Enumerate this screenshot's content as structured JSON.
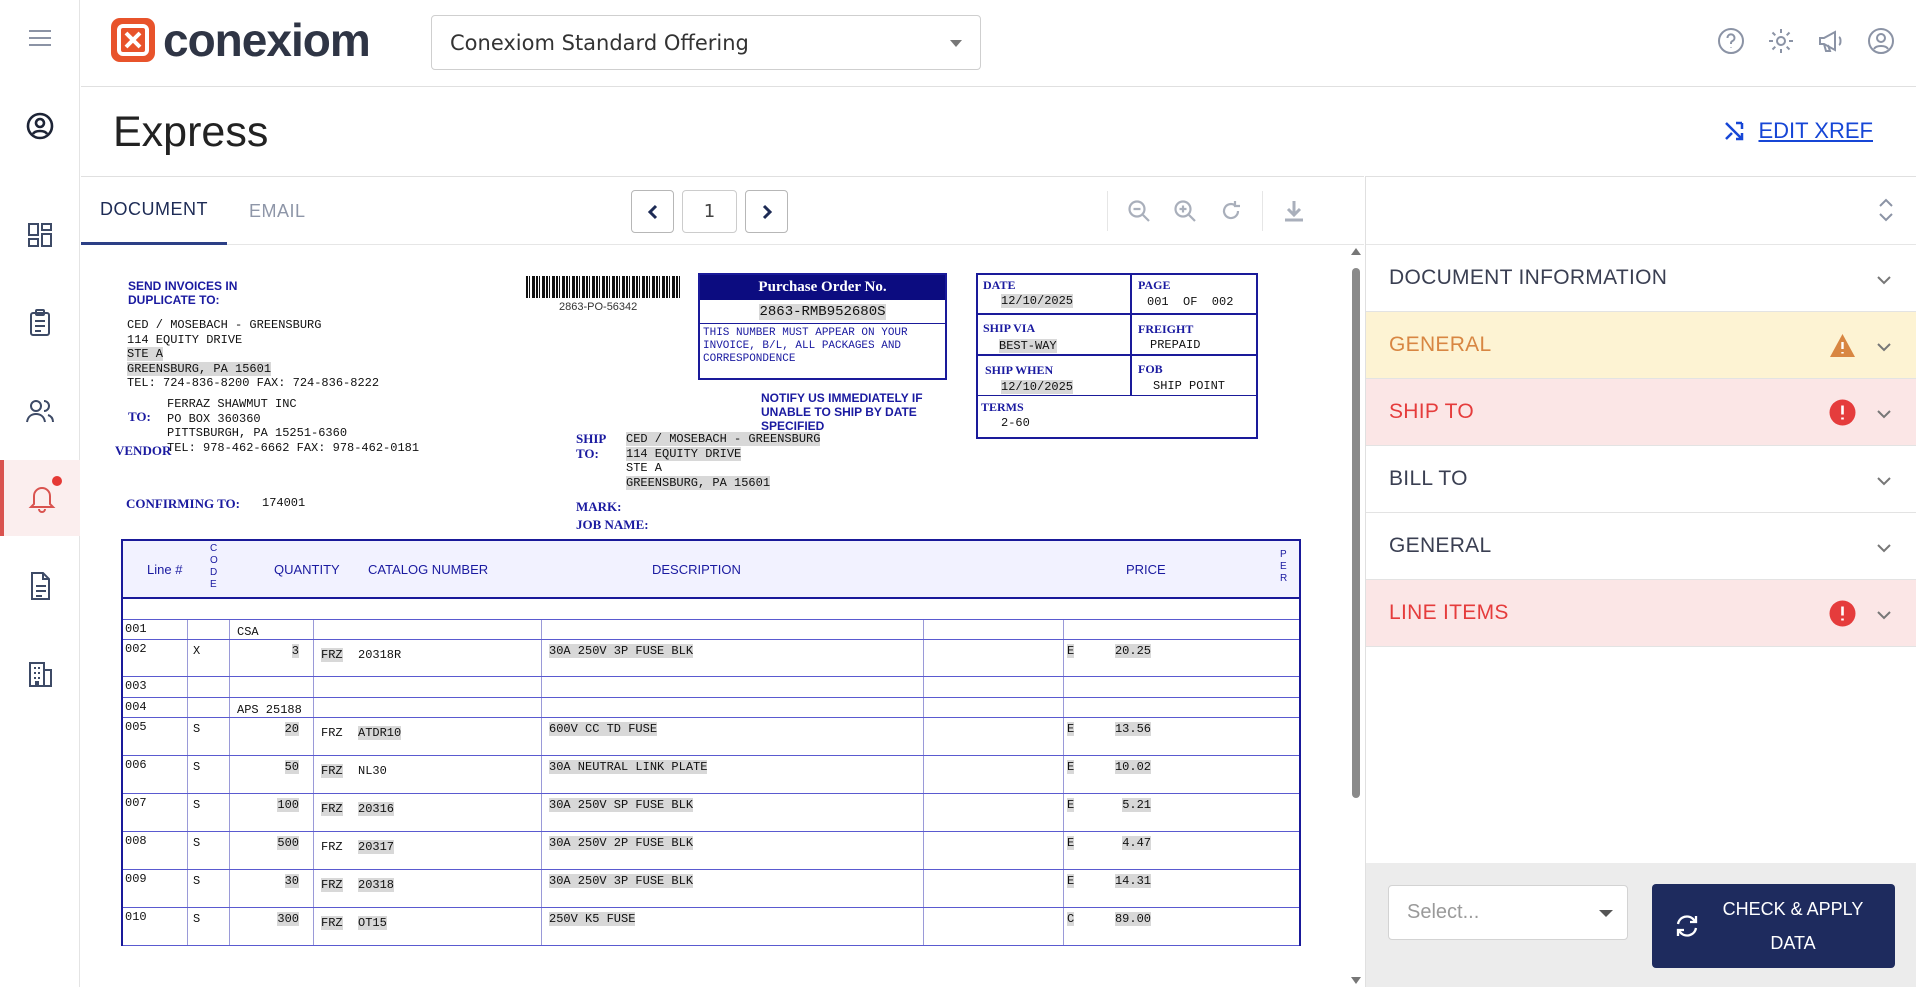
{
  "header": {
    "brand": "conexiom",
    "offering_select": "Conexiom Standard Offering",
    "icons": [
      "help-icon",
      "settings-icon",
      "announcement-icon",
      "account-icon"
    ]
  },
  "nav": {
    "items": [
      "profile-icon",
      "dashboard-icon",
      "clipboard-icon",
      "users-icon",
      "notifications-icon",
      "document-icon",
      "building-icon"
    ],
    "notification_dot_color": "#e53935"
  },
  "page": {
    "title": "Express",
    "edit_xref": "EDIT XREF"
  },
  "viewer": {
    "tabs": [
      "DOCUMENT",
      "EMAIL"
    ],
    "page_number": "1"
  },
  "document": {
    "send_invoices": "SEND INVOICES IN\nDUPLICATE TO:",
    "bill_addr": [
      "CED / MOSEBACH - GREENSBURG",
      "114 EQUITY DRIVE",
      "STE A",
      "GREENSBURG,   PA   15601",
      "TEL: 724-836-8200    FAX: 724-836-8222"
    ],
    "to_label": "TO:",
    "vendor_label": "VENDOR",
    "vendor_addr": [
      "FERRAZ SHAWMUT INC",
      "PO BOX 360360",
      "PITTSBURGH, PA 15251-6360",
      "TEL: 978-462-6662 FAX: 978-462-0181"
    ],
    "confirming_label": "CONFIRMING TO:",
    "confirming_value": "174001",
    "barcode_text": "2863-PO-56342",
    "po_title": "Purchase Order No.",
    "po_number": "2863-RMB952680S",
    "po_message": "THIS NUMBER MUST APPEAR ON YOUR INVOICE, B/L, ALL PACKAGES AND CORRESPONDENCE",
    "notify": "NOTIFY US IMMEDIATELY IF\nUNABLE TO SHIP BY DATE\nSPECIFIED",
    "ship_to_label": "SHIP\nTO:",
    "ship_addr": [
      "CED / MOSEBACH - GREENSBURG",
      "114 EQUITY DRIVE",
      "STE A",
      "GREENSBURG, PA 15601"
    ],
    "mark_label": "MARK:",
    "job_label": "JOB NAME:",
    "date_label": "DATE",
    "date_value": "12/10/2025",
    "page_label": "PAGE",
    "page_value": "001  OF  002",
    "ship_via_label": "SHIP VIA",
    "ship_via_value": "BEST-WAY",
    "freight_label": "FREIGHT",
    "freight_value": "PREPAID",
    "ship_when_label": "SHIP WHEN",
    "ship_when_value": "12/10/2025",
    "fob_label": "FOB",
    "fob_value": "SHIP POINT",
    "terms_label": "TERMS",
    "terms_value": "2-60",
    "table_headers": {
      "line": "Line #",
      "code": "C\nO\nD\nE",
      "qty": "QUANTITY",
      "catalog": "CATALOG NUMBER",
      "desc": "DESCRIPTION",
      "price": "PRICE",
      "per": "P\nE\nR"
    },
    "rows": [
      {
        "line": "001",
        "code": "",
        "qty": "",
        "mfr": "",
        "cat": "CSA",
        "desc": "",
        "price": "",
        "per": "",
        "note": true
      },
      {
        "line": "002",
        "code": "X",
        "qty": "3",
        "mfr": "FRZ",
        "cat": "20318R",
        "desc": "30A 250V 3P FUSE BLK",
        "price": "20.25",
        "per": "E"
      },
      {
        "line": "003",
        "code": "",
        "qty": "",
        "mfr": "",
        "cat": "",
        "desc": "",
        "price": "",
        "per": ""
      },
      {
        "line": "004",
        "code": "",
        "qty": "",
        "mfr": "",
        "cat": "APS 25188",
        "desc": "",
        "price": "",
        "per": "",
        "note": true
      },
      {
        "line": "005",
        "code": "S",
        "qty": "20",
        "mfr": "FRZ",
        "cat": "ATDR10",
        "desc": "600V CC TD FUSE",
        "price": "13.56",
        "per": "E"
      },
      {
        "line": "006",
        "code": "S",
        "qty": "50",
        "mfr": "FRZ",
        "cat": "NL30",
        "desc": "30A NEUTRAL LINK PLATE",
        "price": "10.02",
        "per": "E"
      },
      {
        "line": "007",
        "code": "S",
        "qty": "100",
        "mfr": "FRZ",
        "cat": "20316",
        "desc": "30A 250V SP FUSE BLK",
        "price": "5.21",
        "per": "E"
      },
      {
        "line": "008",
        "code": "S",
        "qty": "500",
        "mfr": "FRZ",
        "cat": "20317",
        "desc": "30A 250V 2P FUSE BLK",
        "price": "4.47",
        "per": "E"
      },
      {
        "line": "009",
        "code": "S",
        "qty": "30",
        "mfr": "FRZ",
        "cat": "20318",
        "desc": "30A 250V 3P FUSE BLK",
        "price": "14.31",
        "per": "E"
      },
      {
        "line": "010",
        "code": "S",
        "qty": "300",
        "mfr": "FRZ",
        "cat": "OT15",
        "desc": "250V K5 FUSE",
        "price": "89.00",
        "per": "C"
      }
    ]
  },
  "panel": {
    "sections": [
      {
        "label": "DOCUMENT INFORMATION",
        "status": "normal"
      },
      {
        "label": "GENERAL",
        "status": "warning"
      },
      {
        "label": "SHIP TO",
        "status": "error"
      },
      {
        "label": "BILL TO",
        "status": "normal"
      },
      {
        "label": "GENERAL",
        "status": "normal"
      },
      {
        "label": "LINE ITEMS",
        "status": "error"
      }
    ],
    "select_placeholder": "Select...",
    "apply_button": "CHECK & APPLY\nDATA"
  },
  "colors": {
    "brand_orange": "#e8532b",
    "primary_navy": "#1e2b5e",
    "link_blue": "#1646d6",
    "warning_bg": "#fdf3d3",
    "error_bg": "#fbe6e6",
    "error_red": "#e53c3c",
    "warning_orange": "#d88642"
  }
}
